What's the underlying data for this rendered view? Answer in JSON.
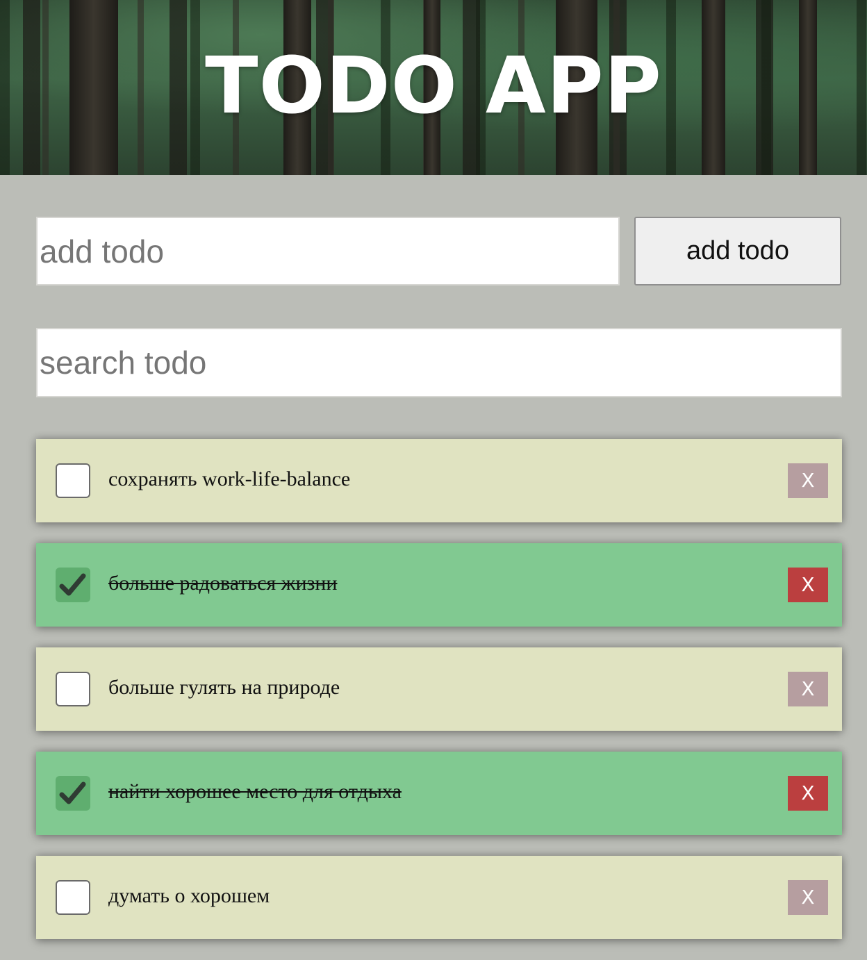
{
  "header": {
    "title": "TODO APP"
  },
  "add_form": {
    "input_placeholder": "add todo",
    "input_value": "",
    "button_label": "add todo"
  },
  "search": {
    "placeholder": "search todo",
    "value": ""
  },
  "todos": [
    {
      "text": "сохранять work-life-balance",
      "done": false,
      "delete_label": "X"
    },
    {
      "text": "больше радоваться жизни",
      "done": true,
      "delete_label": "X"
    },
    {
      "text": "больше гулять на природе",
      "done": false,
      "delete_label": "X"
    },
    {
      "text": "найти хорошее место для отдыха",
      "done": true,
      "delete_label": "X"
    },
    {
      "text": "думать о хорошем",
      "done": false,
      "delete_label": "X"
    }
  ],
  "icons": {
    "checkmark": "check-icon"
  },
  "colors": {
    "page_background": "#bbbdb7",
    "todo_pending": "#e0e3c1",
    "todo_done": "#81c991",
    "delete_pending": "#b69ea0",
    "delete_done": "#bb3f3f"
  }
}
